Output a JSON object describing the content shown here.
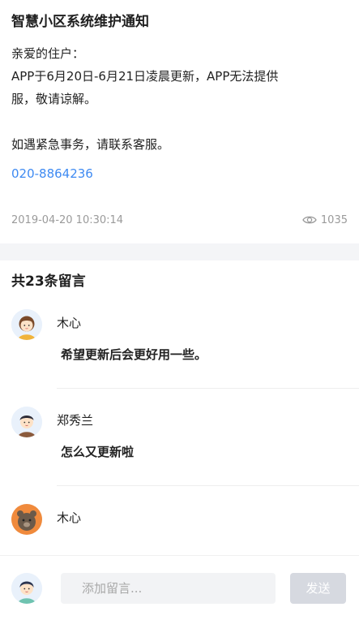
{
  "notice": {
    "title": "智慧小区系统维护通知",
    "greeting": "亲爱的住户：",
    "line1": "APP于6月20日-6月21日凌晨更新，APP无法提供",
    "line2": "服，敬请谅解。",
    "contact_text": "如遇紧急事务，请联系客服。",
    "phone": "020-8864236",
    "timestamp": "2019-04-20 10:30:14",
    "views": "1035",
    "link_color": "#3e8af2"
  },
  "comments": {
    "header": "共23条留言",
    "items": [
      {
        "name": "木心",
        "text": "希望更新后会更好用一些。",
        "avatar": "girl-avatar"
      },
      {
        "name": "郑秀兰",
        "text": "怎么又更新啦",
        "avatar": "boy-avatar"
      },
      {
        "name": "木心",
        "text": "",
        "avatar": "bear-avatar"
      }
    ]
  },
  "input_bar": {
    "placeholder": "添加留言...",
    "send_label": "发送",
    "avatar": "user-avatar"
  }
}
